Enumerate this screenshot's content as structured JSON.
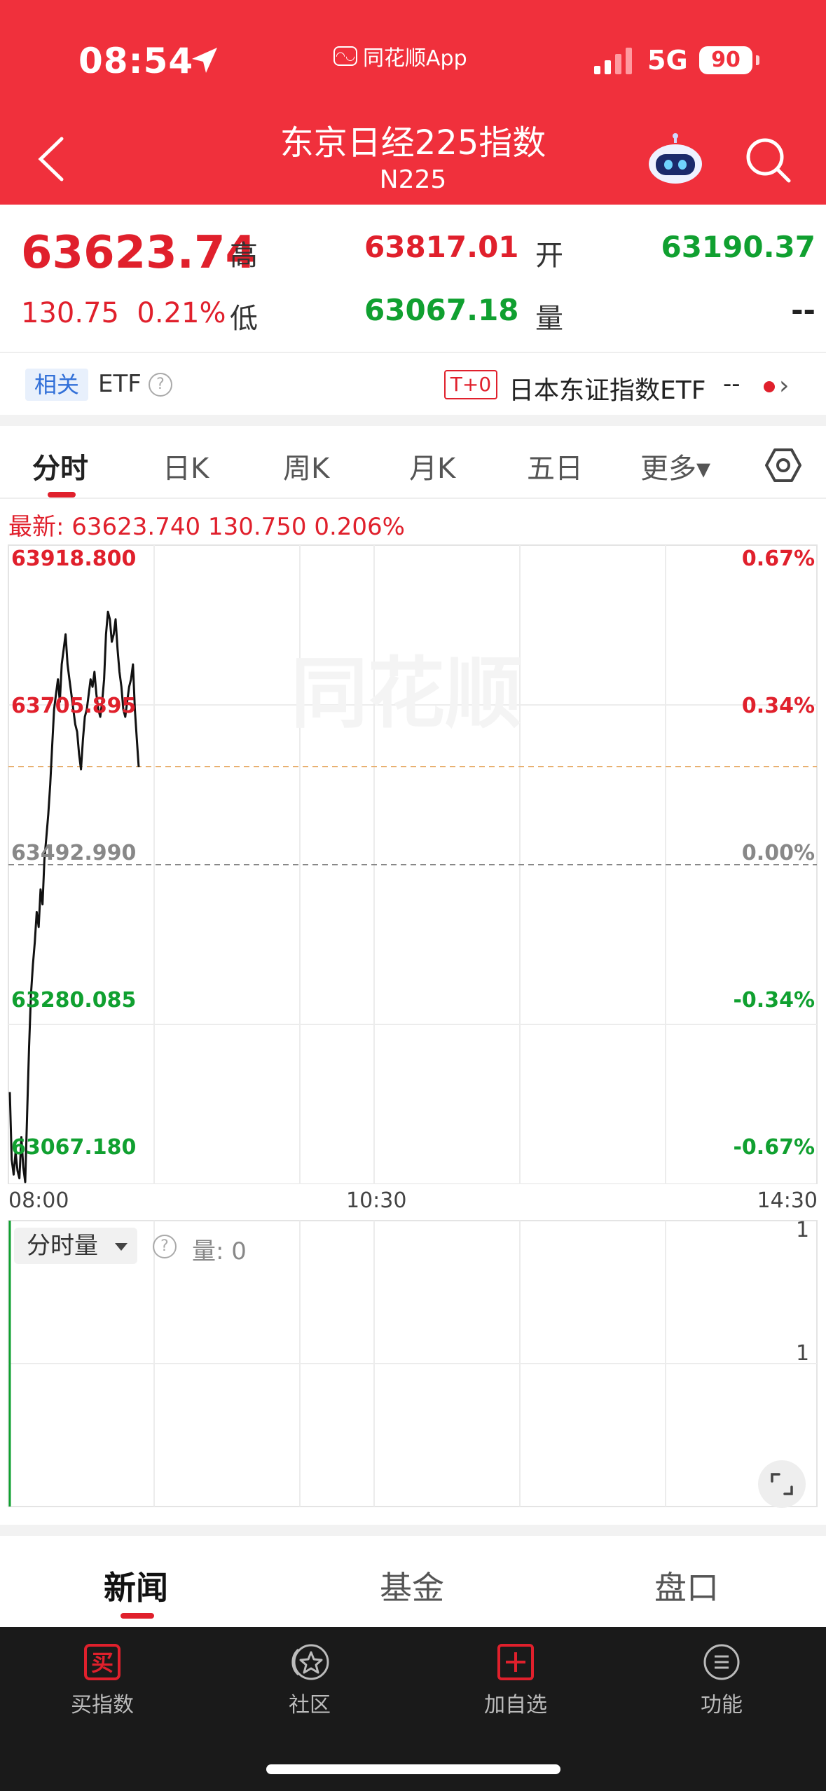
{
  "status_bar": {
    "time": "08:54",
    "app": "同花顺App",
    "network": "5G",
    "battery": "90"
  },
  "header": {
    "title": "东京日经225指数",
    "subtitle": "N225"
  },
  "quote": {
    "price": "63623.74",
    "change": "130.75",
    "change_pct": "0.21%",
    "high_label": "高",
    "high": "63817.01",
    "open_label": "开",
    "open": "63190.37",
    "low_label": "低",
    "low": "63067.18",
    "volume_label": "量",
    "volume": "--"
  },
  "etf": {
    "tag": "相关",
    "label": "ETF",
    "help": "?",
    "t0": "T+0",
    "name": "日本东证指数ETF",
    "value": "--",
    "chevron": "›"
  },
  "tabs": [
    {
      "label": "分时"
    },
    {
      "label": "日K"
    },
    {
      "label": "周K"
    },
    {
      "label": "月K"
    },
    {
      "label": "五日"
    },
    {
      "label": "更多▾"
    }
  ],
  "latest": {
    "text": "最新: 63623.740  130.750  0.206%"
  },
  "chart_data": {
    "type": "line",
    "y_labels_left": [
      "63918.800",
      "63705.895",
      "63492.990",
      "63280.085",
      "63067.180"
    ],
    "y_labels_right": [
      "0.67%",
      "0.34%",
      "0.00%",
      "-0.34%",
      "-0.67%"
    ],
    "x_labels": [
      "08:00",
      "10:30",
      "14:30"
    ],
    "ylim": [
      63067.18,
      63918.8
    ],
    "prev_close": 63492.99,
    "last": 63623.74,
    "watermark": "同花顺",
    "series": [
      {
        "values": [
          63190,
          63100,
          63080,
          63110,
          63085,
          63075,
          63130,
          63090,
          63070,
          63160,
          63250,
          63320,
          63360,
          63390,
          63430,
          63410,
          63460,
          63440,
          63500,
          63530,
          63560,
          63600,
          63650,
          63700,
          63720,
          63740,
          63710,
          63760,
          63780,
          63800,
          63760,
          63740,
          63720,
          63700,
          63680,
          63670,
          63640,
          63620,
          63660,
          63690,
          63700,
          63720,
          63740,
          63730,
          63750,
          63720,
          63700,
          63690,
          63710,
          63740,
          63800,
          63830,
          63820,
          63790,
          63800,
          63820,
          63780,
          63750,
          63730,
          63700,
          63690,
          63710,
          63730,
          63740,
          63760,
          63700,
          63660,
          63623
        ]
      }
    ]
  },
  "volume": {
    "selector": "分时量",
    "help": "?",
    "label": "量: 0",
    "right_top": "1",
    "right_mid": "1"
  },
  "bottom_tabs": [
    {
      "label": "新闻"
    },
    {
      "label": "基金"
    },
    {
      "label": "盘口"
    }
  ],
  "nav": [
    {
      "label": "买指数",
      "icon": "买"
    },
    {
      "label": "社区"
    },
    {
      "label": "加自选"
    },
    {
      "label": "功能"
    }
  ]
}
